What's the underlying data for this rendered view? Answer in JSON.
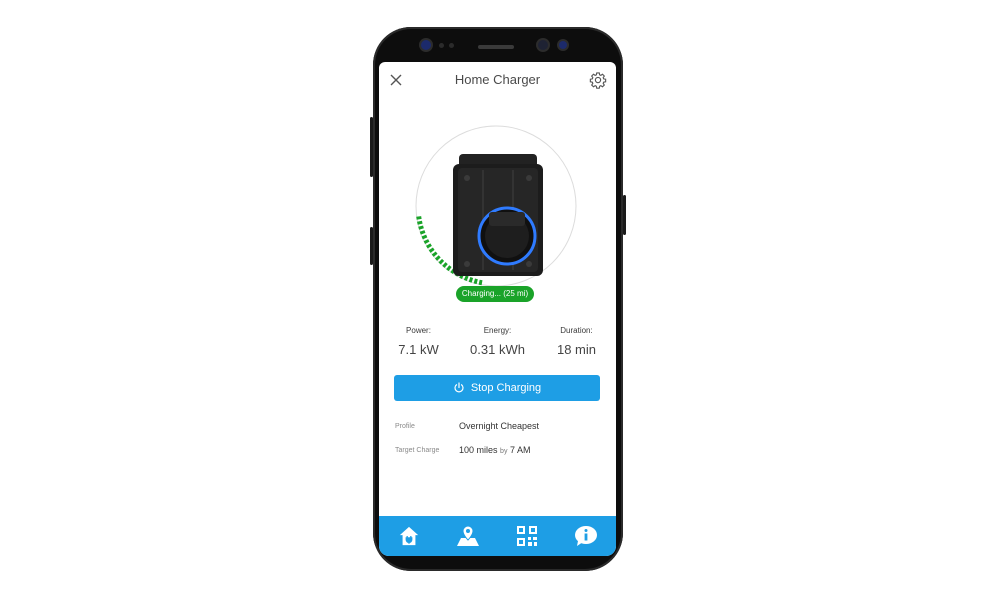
{
  "header": {
    "title": "Home Charger"
  },
  "charger": {
    "status": "Charging... (25 mi)",
    "progress_fraction": 0.2
  },
  "stats": [
    {
      "label": "Power:",
      "value": "7.1 kW"
    },
    {
      "label": "Energy:",
      "value": "0.31 kWh"
    },
    {
      "label": "Duration:",
      "value": "18 min"
    }
  ],
  "action": {
    "stop_label": "Stop Charging"
  },
  "details": {
    "profile_label": "Profile",
    "profile_value": "Overnight Cheapest",
    "target_label": "Target Charge",
    "target_amount": "100 miles",
    "target_by": "by",
    "target_time": "7 AM"
  },
  "nav": [
    {
      "icon": "home-plug-icon"
    },
    {
      "icon": "map-pin-icon"
    },
    {
      "icon": "qr-code-icon"
    },
    {
      "icon": "info-icon"
    }
  ],
  "colors": {
    "accent": "#1e9ee5",
    "charging_green": "#1aa329"
  }
}
